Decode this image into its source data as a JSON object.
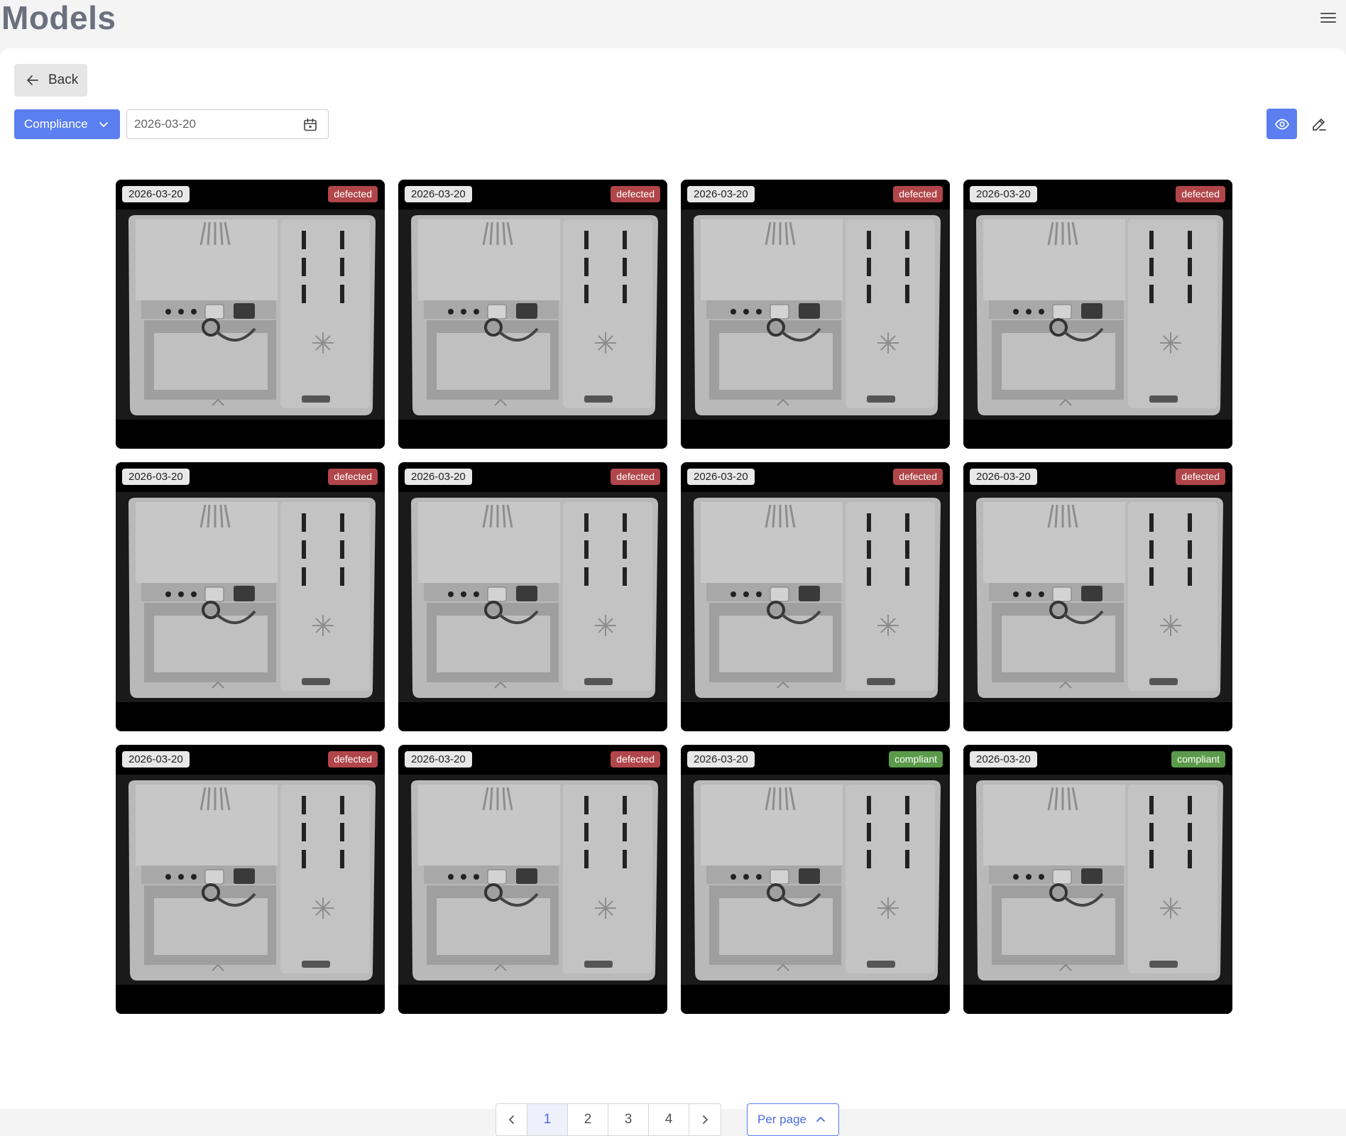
{
  "header": {
    "title": "Models",
    "menu_icon": "hamburger-menu-icon"
  },
  "toolbar": {
    "back_label": "Back",
    "filter_label": "Compliance",
    "date_value": "2026-03-20",
    "view_icon": "eye-icon",
    "edit_icon": "edit-icon"
  },
  "cards": [
    {
      "date": "2026-03-20",
      "status": "defected"
    },
    {
      "date": "2026-03-20",
      "status": "defected"
    },
    {
      "date": "2026-03-20",
      "status": "defected"
    },
    {
      "date": "2026-03-20",
      "status": "defected"
    },
    {
      "date": "2026-03-20",
      "status": "defected"
    },
    {
      "date": "2026-03-20",
      "status": "defected"
    },
    {
      "date": "2026-03-20",
      "status": "defected"
    },
    {
      "date": "2026-03-20",
      "status": "defected"
    },
    {
      "date": "2026-03-20",
      "status": "defected"
    },
    {
      "date": "2026-03-20",
      "status": "defected"
    },
    {
      "date": "2026-03-20",
      "status": "compliant"
    },
    {
      "date": "2026-03-20",
      "status": "compliant"
    }
  ],
  "pagination": {
    "pages": [
      "1",
      "2",
      "3",
      "4"
    ],
    "current": "1"
  },
  "per_page_label": "Per page",
  "colors": {
    "accent": "#5b7ff0",
    "defected": "#b0464a",
    "compliant": "#5a9a4a"
  }
}
